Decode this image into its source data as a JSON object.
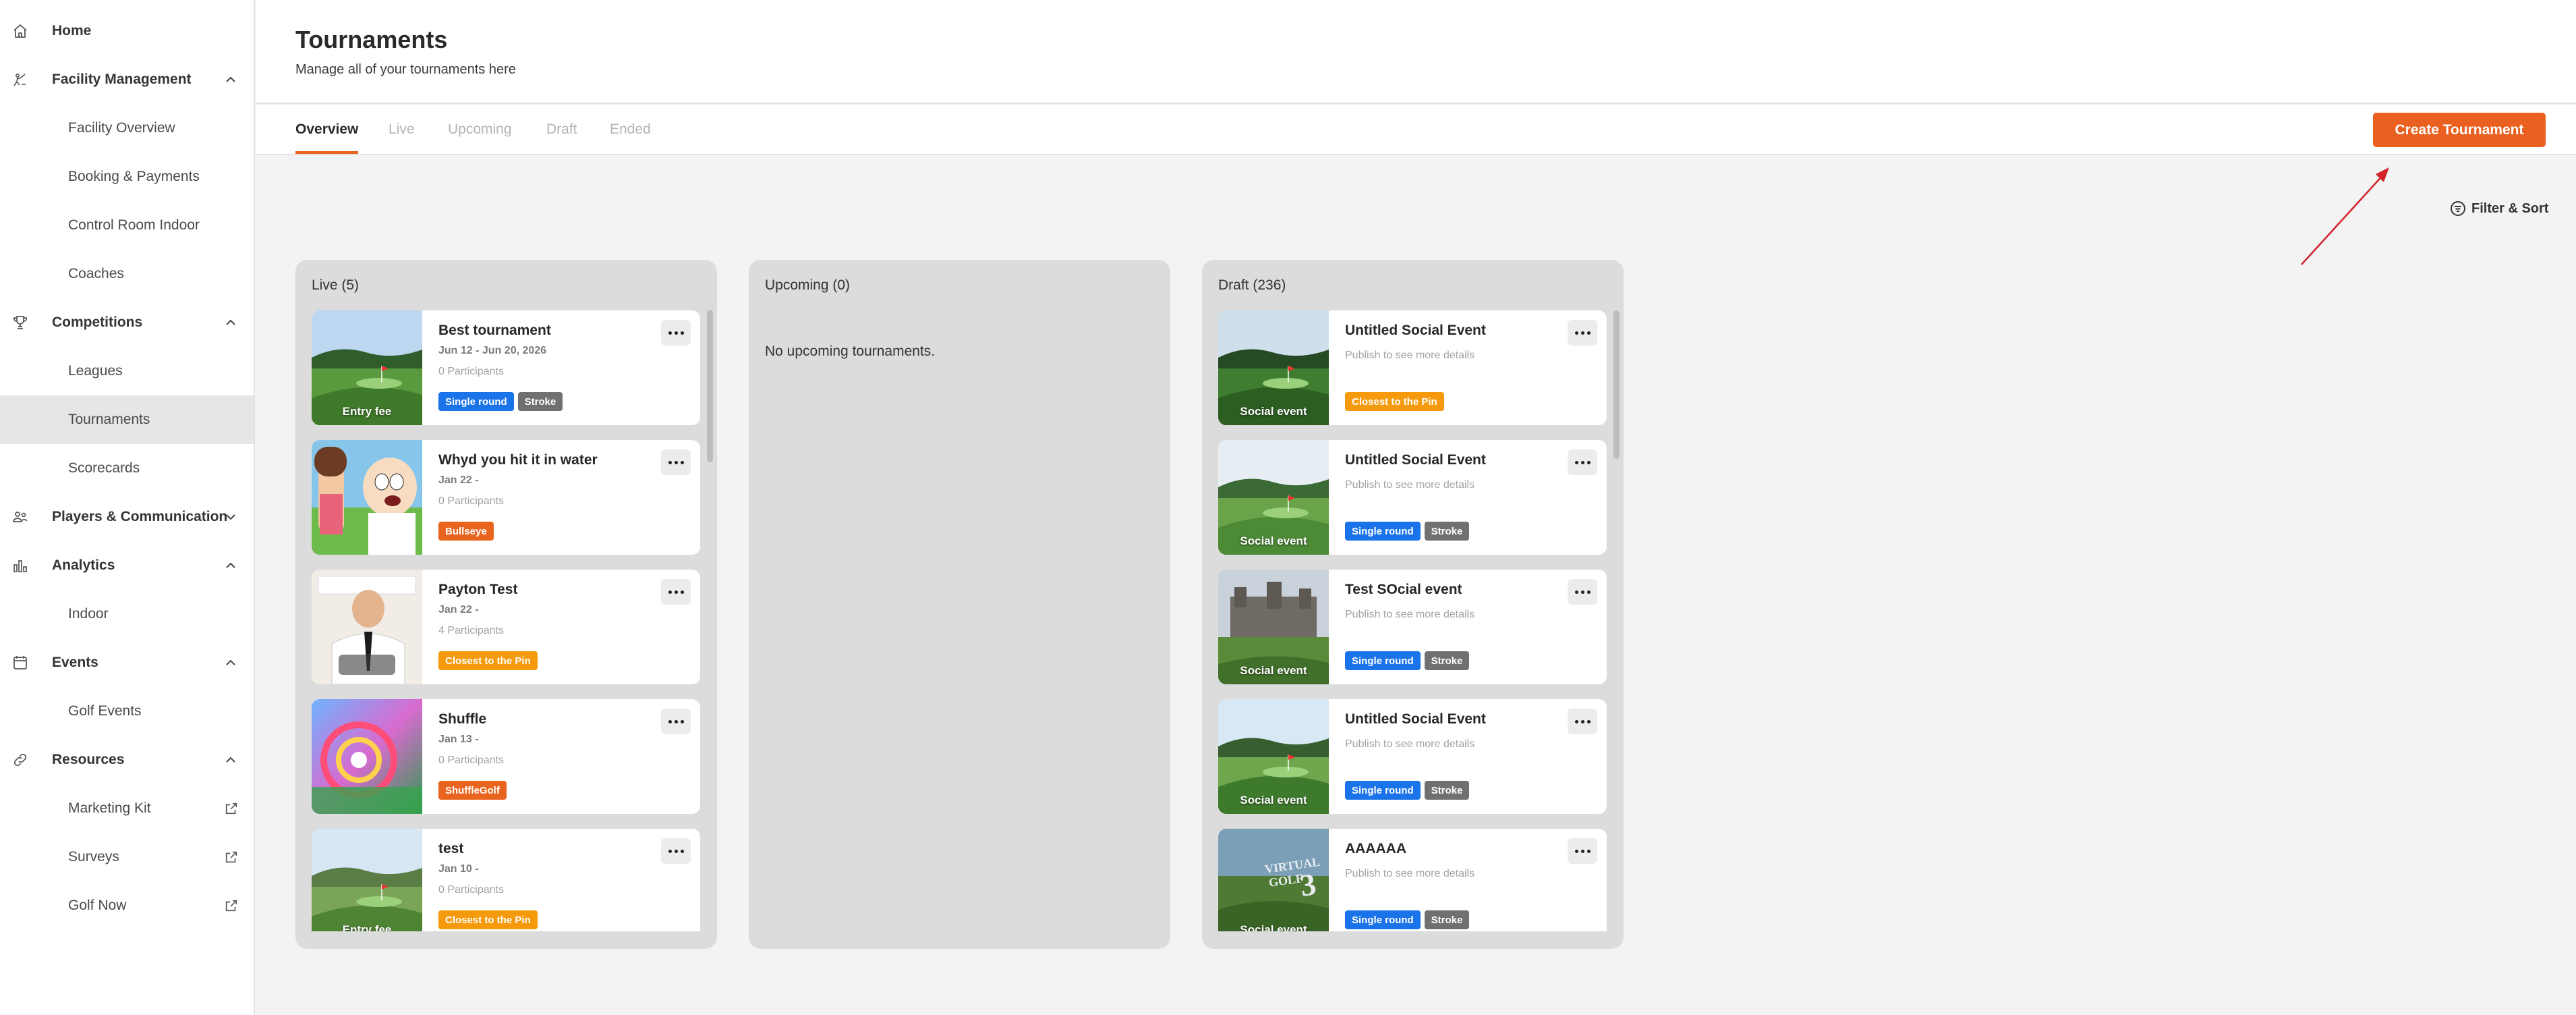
{
  "sidebar": {
    "items": [
      {
        "label": "Home",
        "icon": "home-icon",
        "type": "parent",
        "chevron": ""
      },
      {
        "label": "Facility Management",
        "icon": "facility-icon",
        "type": "parent",
        "chevron": "up"
      },
      {
        "label": "Facility Overview",
        "type": "child"
      },
      {
        "label": "Booking & Payments",
        "type": "child"
      },
      {
        "label": "Control Room Indoor",
        "type": "child"
      },
      {
        "label": "Coaches",
        "type": "child"
      },
      {
        "label": "Competitions",
        "icon": "trophy-icon",
        "type": "parent",
        "chevron": "up"
      },
      {
        "label": "Leagues",
        "type": "child"
      },
      {
        "label": "Tournaments",
        "type": "child",
        "active": true
      },
      {
        "label": "Scorecards",
        "type": "child"
      },
      {
        "label": "Players & Communication",
        "icon": "players-icon",
        "type": "parent",
        "chevron": "down"
      },
      {
        "label": "Analytics",
        "icon": "analytics-icon",
        "type": "parent",
        "chevron": "up"
      },
      {
        "label": "Indoor",
        "type": "child"
      },
      {
        "label": "Events",
        "icon": "calendar-icon",
        "type": "parent",
        "chevron": "up"
      },
      {
        "label": "Golf Events",
        "type": "child"
      },
      {
        "label": "Resources",
        "icon": "link-icon",
        "type": "parent",
        "chevron": "up"
      },
      {
        "label": "Marketing Kit",
        "type": "child",
        "external": true
      },
      {
        "label": "Surveys",
        "type": "child",
        "external": true
      },
      {
        "label": "Golf Now",
        "type": "child",
        "external": true
      }
    ]
  },
  "header": {
    "title": "Tournaments",
    "subtitle": "Manage all of your tournaments here"
  },
  "tabs": [
    {
      "label": "Overview",
      "active": true
    },
    {
      "label": "Live"
    },
    {
      "label": "Upcoming"
    },
    {
      "label": "Draft"
    },
    {
      "label": "Ended"
    }
  ],
  "actions": {
    "create_label": "Create Tournament",
    "filter_label": "Filter & Sort"
  },
  "colors": {
    "accent": "#ea6020",
    "single_round": "#1a73e8",
    "stroke": "#707070",
    "bullseye": "#e8641f",
    "closest": "#f59a0c",
    "shuffle": "#e8641f"
  },
  "columns": [
    {
      "title": "Live (5)",
      "cards": [
        {
          "title": "Best tournament",
          "date": "Jun 12 - Jun 20, 2026",
          "participants": "0 Participants",
          "caption": "Entry fee",
          "thumb": "course1",
          "badges": [
            {
              "label": "Single round",
              "color": "#1a73e8"
            },
            {
              "label": "Stroke",
              "color": "#707070"
            }
          ]
        },
        {
          "title": "Whyd you hit it in water",
          "date": "Jan 22 -",
          "participants": "0 Participants",
          "caption": "",
          "thumb": "cartoon",
          "badges": [
            {
              "label": "Bullseye",
              "color": "#e8641f"
            }
          ]
        },
        {
          "title": "Payton Test",
          "date": "Jan 22 -",
          "participants": "4 Participants",
          "caption": "",
          "thumb": "person",
          "badges": [
            {
              "label": "Closest to the Pin",
              "color": "#f59a0c"
            }
          ]
        },
        {
          "title": "Shuffle",
          "date": "Jan 13 -",
          "participants": "0 Participants",
          "caption": "",
          "thumb": "shuffle",
          "badges": [
            {
              "label": "ShuffleGolf",
              "color": "#e8641f"
            }
          ]
        },
        {
          "title": "test",
          "date": "Jan 10 -",
          "participants": "0 Participants",
          "caption": "Entry fee",
          "thumb": "course2",
          "badges": [
            {
              "label": "Closest to the Pin",
              "color": "#f59a0c"
            }
          ]
        }
      ]
    },
    {
      "title": "Upcoming (0)",
      "empty": "No upcoming tournaments.",
      "cards": []
    },
    {
      "title": "Draft (236)",
      "cards": [
        {
          "title": "Untitled Social Event",
          "publish": "Publish to see more details",
          "caption": "Social event",
          "thumb": "course3",
          "badges": [
            {
              "label": "Closest to the Pin",
              "color": "#f59a0c"
            }
          ]
        },
        {
          "title": "Untitled Social Event",
          "publish": "Publish to see more details",
          "caption": "Social event",
          "thumb": "course4",
          "badges": [
            {
              "label": "Single round",
              "color": "#1a73e8"
            },
            {
              "label": "Stroke",
              "color": "#707070"
            }
          ]
        },
        {
          "title": "Test SOcial event",
          "publish": "Publish to see more details",
          "caption": "Social event",
          "thumb": "castle",
          "badges": [
            {
              "label": "Single round",
              "color": "#1a73e8"
            },
            {
              "label": "Stroke",
              "color": "#707070"
            }
          ]
        },
        {
          "title": "Untitled Social Event",
          "publish": "Publish to see more details",
          "caption": "Social event",
          "thumb": "course5",
          "badges": [
            {
              "label": "Single round",
              "color": "#1a73e8"
            },
            {
              "label": "Stroke",
              "color": "#707070"
            }
          ]
        },
        {
          "title": "AAAAAA",
          "publish": "Publish to see more details",
          "caption": "Social event",
          "thumb": "vg3",
          "badges": [
            {
              "label": "Single round",
              "color": "#1a73e8"
            },
            {
              "label": "Stroke",
              "color": "#707070"
            }
          ]
        }
      ]
    }
  ]
}
